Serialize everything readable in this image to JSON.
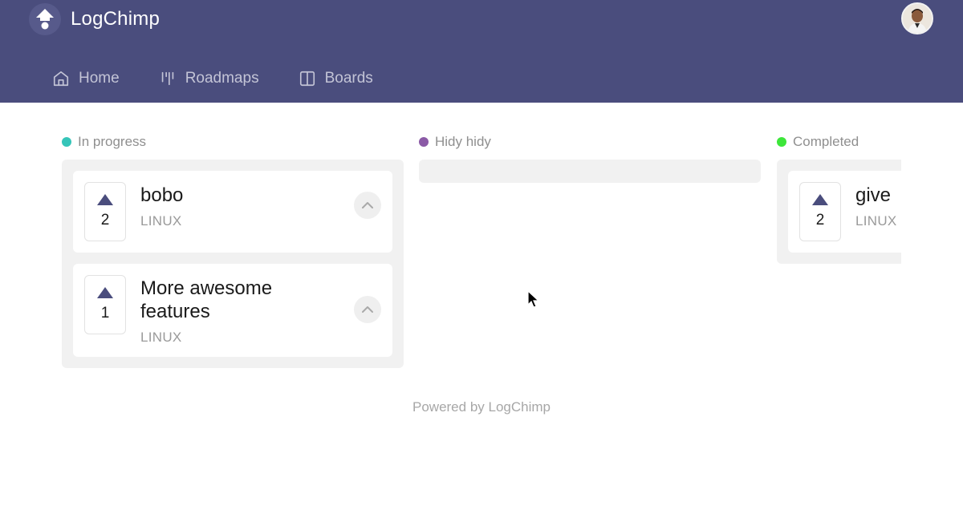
{
  "header": {
    "brand": "LogChimp",
    "logo_icon": "logchimp-logo-icon",
    "avatar_icon": "user-avatar",
    "nav": [
      {
        "label": "Home",
        "icon": "home-icon"
      },
      {
        "label": "Roadmaps",
        "icon": "roadmap-icon"
      },
      {
        "label": "Boards",
        "icon": "boards-icon"
      }
    ]
  },
  "roadmap": {
    "columns": [
      {
        "title": "In progress",
        "color": "#36c5b9",
        "cards": [
          {
            "votes": "2",
            "title": "bobo",
            "board": "LINUX"
          },
          {
            "votes": "1",
            "title": "More awesome features",
            "board": "LINUX"
          }
        ]
      },
      {
        "title": "Hidy hidy",
        "color": "#8b5aa6",
        "cards": []
      },
      {
        "title": "Completed",
        "color": "#3de63a",
        "cards": [
          {
            "votes": "2",
            "title": "give",
            "board": "LINUX"
          }
        ]
      }
    ]
  },
  "footer": {
    "text": "Powered by LogChimp"
  },
  "colors": {
    "header_bg": "#4a4d7d",
    "accent": "#4a4d7d"
  }
}
